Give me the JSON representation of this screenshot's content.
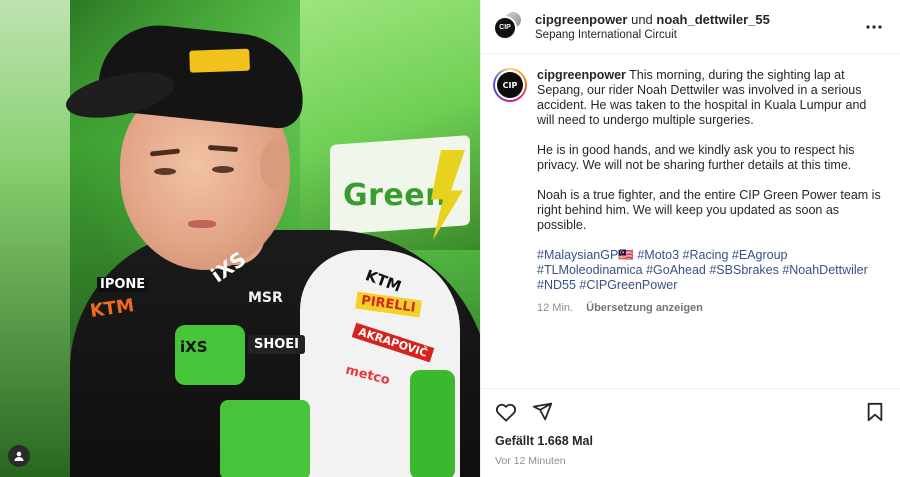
{
  "header": {
    "user1": "cipgreenpower",
    "joiner": "und",
    "user2": "noah_dettwiler_55",
    "location": "Sepang International Circuit",
    "avatar_text": "CIP"
  },
  "post": {
    "username": "cipgreenpower",
    "paragraphs": [
      "This morning, during the sighting lap at Sepang, our rider Noah Dettwiler was involved in a serious accident. He was taken to the hospital in Kuala Lumpur and will need to undergo multiple surgeries.",
      "He is in good hands, and we kindly ask you to respect his privacy. We will not be sharing further details at this time.",
      "Noah is a true fighter, and the entire CIP Green Power team is right behind him. We will keep you updated as soon as possible."
    ],
    "hashtags": [
      "#MalaysianGP🇲🇾",
      "#Moto3",
      "#Racing",
      "#EAgroup",
      "#TLMoleodinamica",
      "#GoAhead",
      "#SBSbrakes",
      "#NoahDettwiler",
      "#ND55",
      "#CIPGreenPower"
    ],
    "time_short": "12 Min.",
    "translate": "Übersetzung anzeigen"
  },
  "footer": {
    "likes": "Gefällt 1.668 Mal",
    "posted": "Vor 12 Minuten"
  },
  "photo": {
    "banner_word": "Green",
    "sponsors": {
      "ktm": "KTM",
      "ixs": "iXS",
      "msr": "MSR",
      "shoei": "SHOEI",
      "pirelli": "PIRELLI",
      "akrapovic": "AKRAPOVIČ",
      "metco": "metco",
      "ipone": "IPONE"
    }
  },
  "colors": {
    "link": "#385185",
    "muted": "#8e8e8e",
    "text": "#262626"
  },
  "icons": [
    "more-icon",
    "heart-icon",
    "share-icon",
    "bookmark-icon",
    "user-icon"
  ]
}
